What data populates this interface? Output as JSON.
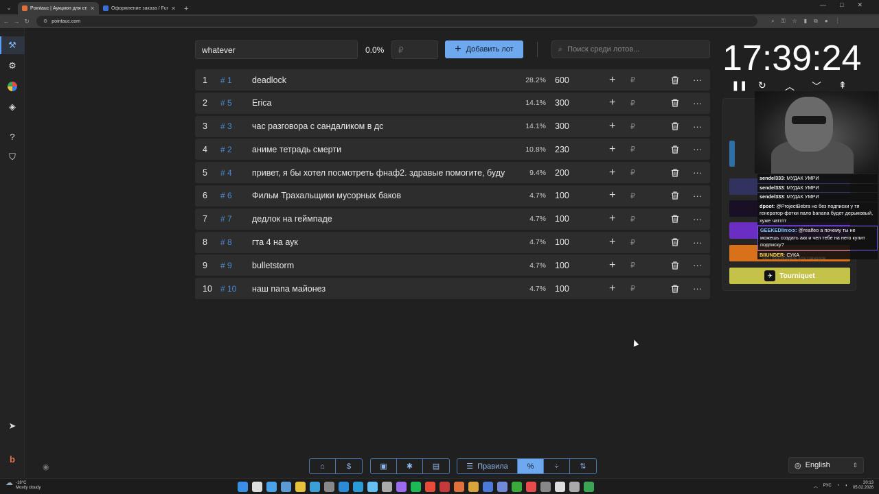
{
  "browser": {
    "tabs": [
      {
        "title": "Pointauc | Аукцион для стрим...",
        "active": true,
        "fav": "#e0713c"
      },
      {
        "title": "Оформление заказа / FunPay",
        "active": false,
        "fav": "#3a6fd8"
      }
    ],
    "url": "pointauc.com"
  },
  "toolbar": {
    "lot_name_value": "whatever",
    "total_percent": "0.0%",
    "amount_placeholder": "₽",
    "add_lot_label": "Добавить лот",
    "search_placeholder": "Поиск среди лотов..."
  },
  "lots": [
    {
      "num": "1",
      "id": "# 1",
      "name": "deadlock",
      "pct": "28.2%",
      "amount": "600"
    },
    {
      "num": "2",
      "id": "# 5",
      "name": "Erica",
      "pct": "14.1%",
      "amount": "300"
    },
    {
      "num": "3",
      "id": "# 3",
      "name": "час разговора с сандаликом в дс",
      "pct": "14.1%",
      "amount": "300"
    },
    {
      "num": "4",
      "id": "# 2",
      "name": "аниме тетрадь смерти",
      "pct": "10.8%",
      "amount": "230"
    },
    {
      "num": "5",
      "id": "# 4",
      "name": "привет, я бы хотел посмотреть фнаф2. здравые помогите, буду",
      "pct": "9.4%",
      "amount": "200"
    },
    {
      "num": "6",
      "id": "# 6",
      "name": "Фильм Трахальщики мусорных баков",
      "pct": "4.7%",
      "amount": "100"
    },
    {
      "num": "7",
      "id": "# 7",
      "name": "дедлок на геймпаде",
      "pct": "4.7%",
      "amount": "100"
    },
    {
      "num": "8",
      "id": "# 8",
      "name": "гта 4 на аук",
      "pct": "4.7%",
      "amount": "100"
    },
    {
      "num": "9",
      "id": "# 9",
      "name": "bulletstorm",
      "pct": "4.7%",
      "amount": "100"
    },
    {
      "num": "10",
      "id": "# 10",
      "name": "наш папа майонез",
      "pct": "4.7%",
      "amount": "100"
    }
  ],
  "row_icons": {
    "plus": "+",
    "currency": "₽",
    "more": "···"
  },
  "timer": {
    "display": "17:39:24"
  },
  "panel": {
    "tourniquet_label": "Tourniquet",
    "button_colors": [
      "#2f6fa8",
      "#31335e",
      "#1a1026",
      "#6b2ec2",
      "#d9711a"
    ]
  },
  "chat": [
    {
      "user": "sendel333",
      "color": "#ffffff",
      "text": "МУДАК УМРИ"
    },
    {
      "user": "sendel333",
      "color": "#ffffff",
      "text": "МУДАК УМРИ"
    },
    {
      "user": "sendel333",
      "color": "#ffffff",
      "text": "МУДАК УМРИ"
    },
    {
      "user": "dpoot",
      "color": "#ffffff",
      "text": "@ProjectBebra но без подписки у тя генератор-фотки пало banana будет дерьмовый, хуже чатгпт"
    },
    {
      "user": "GEEKEDlinxxx",
      "color": "#7ec8ff",
      "text": "@realfeo а почему ты не можешь создать акк и чел тебе на него купит подписку?",
      "hl": true
    },
    {
      "user": "BIIUNDER",
      "color": "#ffd84a",
      "text": "СУКА"
    }
  ],
  "ghost_text": "это говномодель для говнодов",
  "bottom_toolbar": {
    "rules_label": "Правила",
    "language": "English"
  },
  "taskbar": {
    "temp": "-18°C",
    "weather": "Mostly cloudy",
    "lang": "РУС",
    "time": "20:13",
    "date": "05.02.2026"
  }
}
